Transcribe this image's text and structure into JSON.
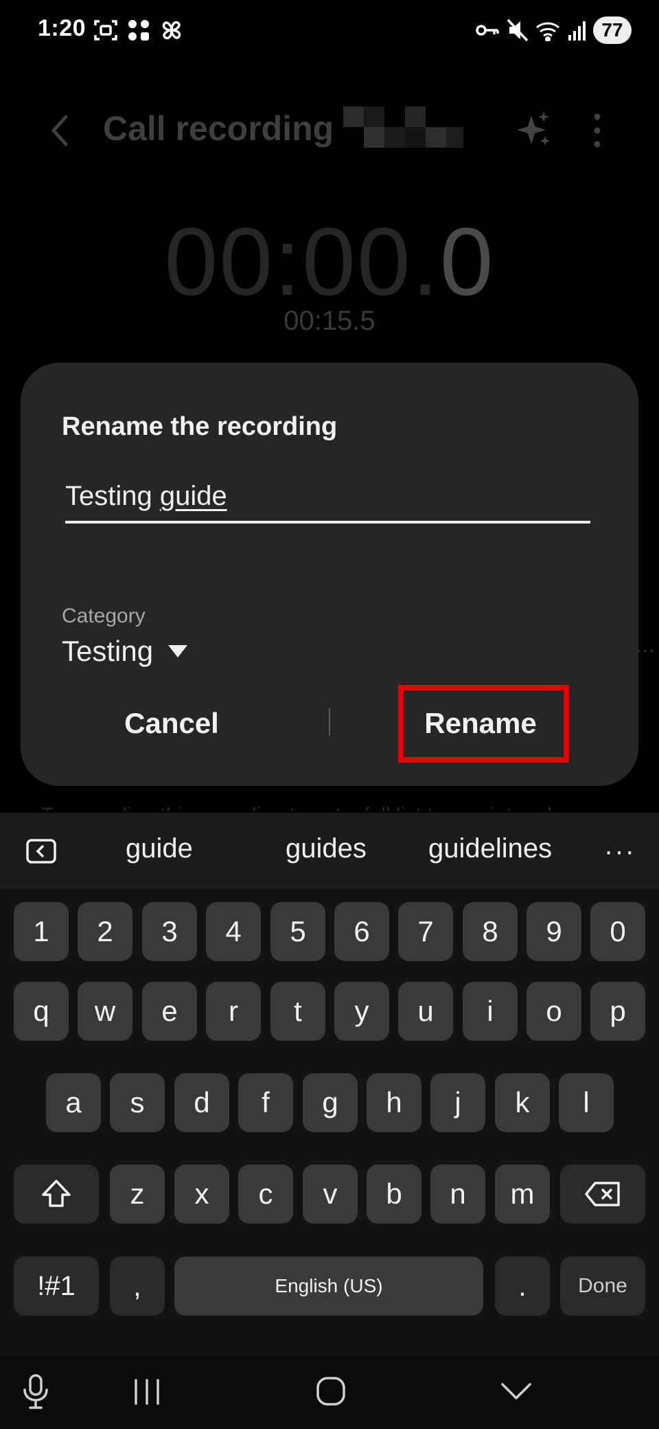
{
  "status_bar": {
    "time": "1:20",
    "battery": "77",
    "icons": [
      "screenshot-icon",
      "apps-grid-icon",
      "pinwheel-icon",
      "vpn-key-icon",
      "mute-icon",
      "wifi-icon",
      "signal-icon",
      "battery-icon"
    ]
  },
  "background_app": {
    "title": "Call recording",
    "timer_main": "00:00.",
    "timer_tenth": "0",
    "timer_sub": "00:15.5",
    "hint": "To recording this recording to get a full list transcript and"
  },
  "dialog": {
    "title": "Rename the recording",
    "name_value": "Testing ",
    "name_composing": "guide",
    "category_label": "Category",
    "category_value": "Testing",
    "cancel_label": "Cancel",
    "rename_label": "Rename",
    "highlight_color": "#e80000"
  },
  "keyboard": {
    "suggestions": [
      "guide",
      "guides",
      "guidelines"
    ],
    "more": "···",
    "row_numbers": [
      "1",
      "2",
      "3",
      "4",
      "5",
      "6",
      "7",
      "8",
      "9",
      "0"
    ],
    "row_1": [
      "q",
      "w",
      "e",
      "r",
      "t",
      "y",
      "u",
      "i",
      "o",
      "p"
    ],
    "row_2": [
      "a",
      "s",
      "d",
      "f",
      "g",
      "h",
      "j",
      "k",
      "l"
    ],
    "row_3": [
      "z",
      "x",
      "c",
      "v",
      "b",
      "n",
      "m"
    ],
    "symbols_label": "!#1",
    "comma_label": ",",
    "space_label": "English (US)",
    "period_label": ".",
    "done_label": "Done"
  },
  "navbar": {
    "icons": [
      "mic-icon",
      "recents-icon",
      "home-icon",
      "hide-keyboard-icon"
    ]
  }
}
